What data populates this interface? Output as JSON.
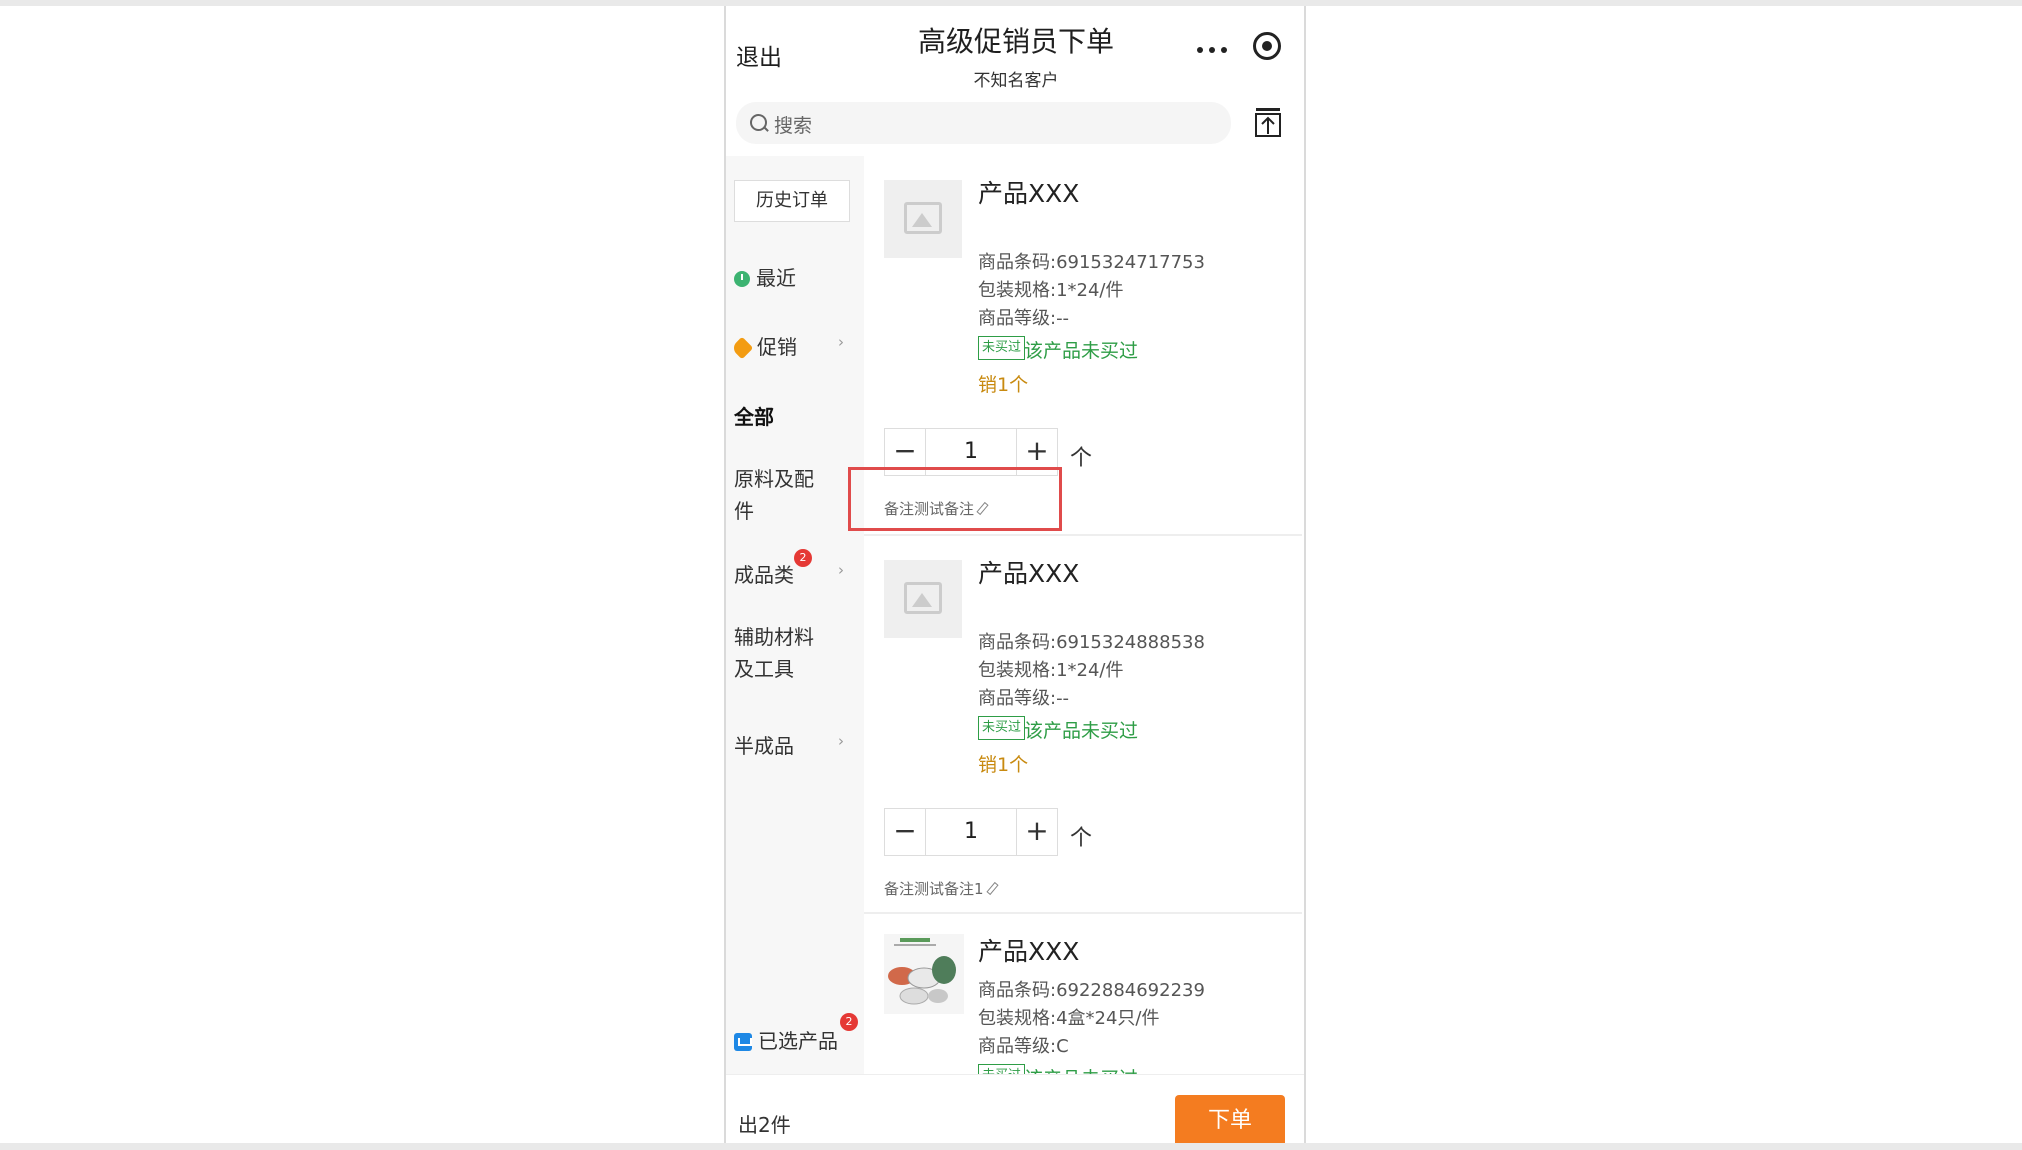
{
  "header": {
    "exit_label": "退出",
    "title": "高级促销员下单",
    "subtitle": "不知名客户"
  },
  "search": {
    "placeholder": "搜索"
  },
  "sidebar": {
    "history_label": "历史订单",
    "items": [
      {
        "label": "最近"
      },
      {
        "label": "促销"
      },
      {
        "label": "全部"
      },
      {
        "label": "原料及配件"
      },
      {
        "label": "成品类",
        "badge": "2"
      },
      {
        "label": "辅助材料及工具"
      },
      {
        "label": "半成品"
      }
    ],
    "selected_label": "已选产品",
    "selected_badge": "2"
  },
  "products": [
    {
      "name": "产品XXX",
      "barcode": "商品条码:6915324717753",
      "spec": "包装规格:1*24/件",
      "grade": "商品等级:--",
      "tag": "未买过",
      "tag_text": "该产品未买过",
      "sold": "销1个",
      "quantity": "1",
      "unit": "个",
      "note": "备注测试备注"
    },
    {
      "name": "产品XXX",
      "barcode": "商品条码:6915324888538",
      "spec": "包装规格:1*24/件",
      "grade": "商品等级:--",
      "tag": "未买过",
      "tag_text": "该产品未买过",
      "sold": "销1个",
      "quantity": "1",
      "unit": "个",
      "note": "备注测试备注1"
    },
    {
      "name": "产品XXX",
      "barcode": "商品条码:6922884692239",
      "spec": "包装规格:4盒*24只/件",
      "grade": "商品等级:C",
      "tag": "未买过",
      "tag_text": "该产品未买过"
    }
  ],
  "footer": {
    "count": "出2件",
    "order_label": "下单"
  },
  "colors": {
    "accent": "#f47c20",
    "green": "#2e9d46",
    "highlight": "#e04b4b"
  }
}
